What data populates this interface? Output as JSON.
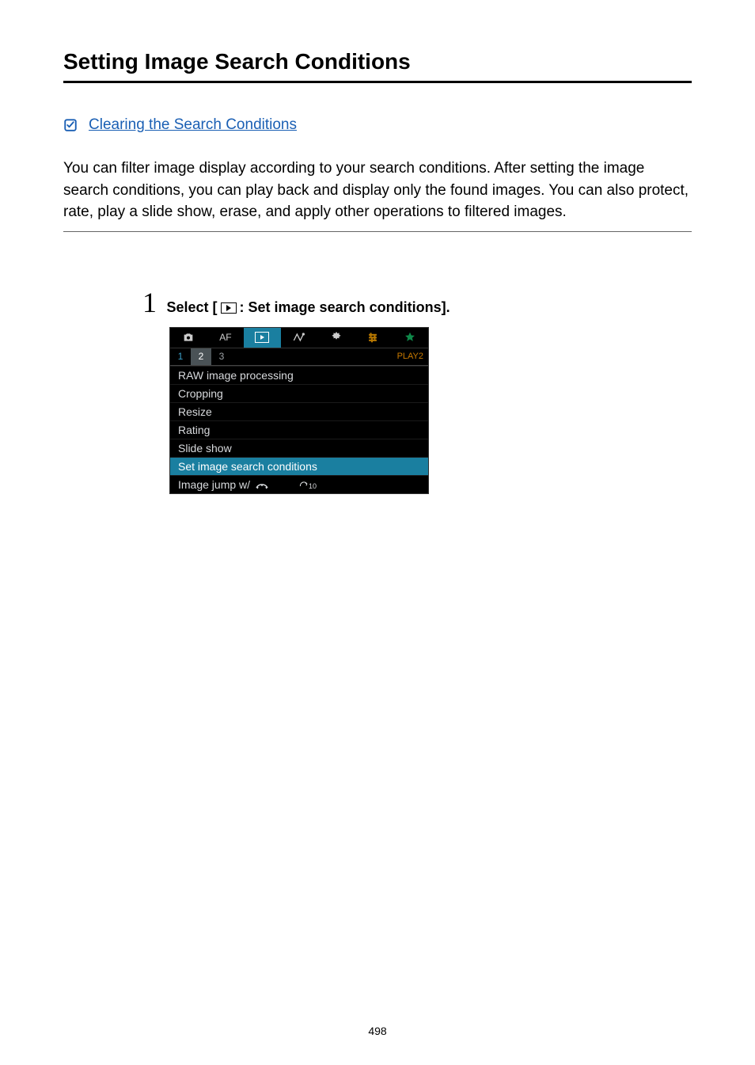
{
  "page": {
    "title": "Setting Image Search Conditions",
    "link_label": "Clearing the Search Conditions",
    "intro": "You can filter image display according to your search conditions. After setting the image search conditions, you can play back and display only the found images. You can also protect, rate, play a slide show, erase, and apply other operations to filtered images.",
    "page_number": "498"
  },
  "step": {
    "number": "1",
    "dot": ".",
    "prefix": "Select [",
    "suffix": ": Set image search conditions]."
  },
  "camera": {
    "tabs": {
      "af": "AF"
    },
    "subtabs": {
      "t1": "1",
      "t2": "2",
      "t3": "3",
      "label": "PLAY2"
    },
    "items": {
      "raw": "RAW image processing",
      "cropping": "Cropping",
      "resize": "Resize",
      "rating": "Rating",
      "slideshow": "Slide show",
      "setcond": "Set image search conditions",
      "jump_prefix": "Image jump w/",
      "jump_value": "10"
    }
  }
}
